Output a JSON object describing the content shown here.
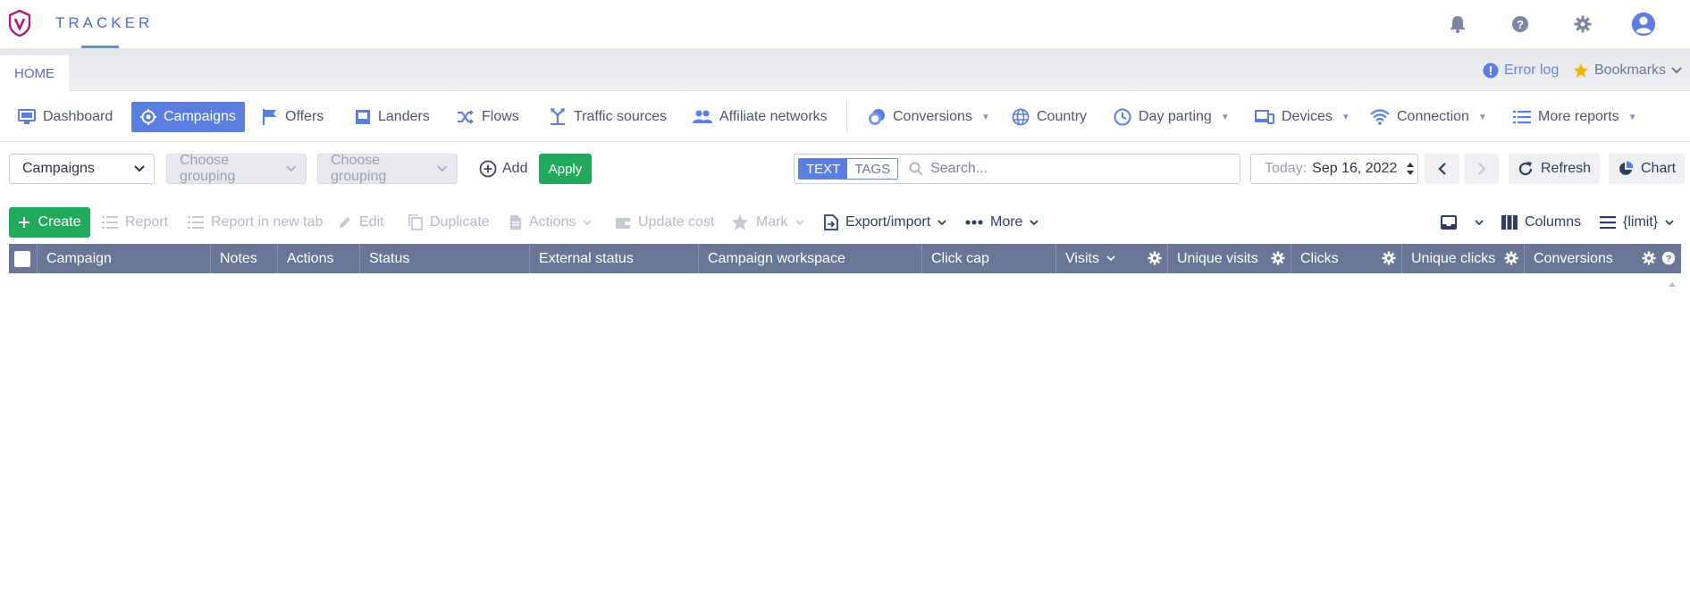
{
  "header": {
    "brand": "TRACKER",
    "icons": [
      "bell-icon",
      "help-icon",
      "gear-icon",
      "account-icon"
    ]
  },
  "tabs": {
    "home": "HOME",
    "error_log": "Error log",
    "bookmarks": "Bookmarks"
  },
  "nav": {
    "items": [
      {
        "label": "Dashboard",
        "icon": "monitor-icon"
      },
      {
        "label": "Campaigns",
        "icon": "target-icon",
        "active": true
      },
      {
        "label": "Offers",
        "icon": "flag-icon"
      },
      {
        "label": "Landers",
        "icon": "lander-icon"
      },
      {
        "label": "Flows",
        "icon": "shuffle-icon"
      },
      {
        "label": "Traffic sources",
        "icon": "split-icon"
      },
      {
        "label": "Affiliate networks",
        "icon": "people-icon"
      },
      {
        "label": "Conversions",
        "icon": "coins-icon"
      },
      {
        "label": "Country",
        "icon": "globe-icon"
      },
      {
        "label": "Day parting",
        "icon": "clock-icon"
      },
      {
        "label": "Devices",
        "icon": "devices-icon"
      },
      {
        "label": "Connection",
        "icon": "wifi-icon"
      },
      {
        "label": "More reports",
        "icon": "list-icon"
      }
    ]
  },
  "filters": {
    "entity_select": "Campaigns",
    "grouping_1": "Choose grouping",
    "grouping_2": "Choose grouping",
    "add": "Add",
    "apply": "Apply",
    "search_mode_text": "TEXT",
    "search_mode_tags": "TAGS",
    "search_placeholder": "Search...",
    "date_label": "Today:",
    "date_value": "Sep 16, 2022",
    "refresh": "Refresh",
    "chart": "Chart"
  },
  "toolbar": {
    "create": "Create",
    "report": "Report",
    "report_new_tab": "Report in new tab",
    "edit": "Edit",
    "duplicate": "Duplicate",
    "actions": "Actions",
    "update_cost": "Update cost",
    "mark": "Mark",
    "export_import": "Export/import",
    "more": "More",
    "columns": "Columns",
    "limit": "{limit}"
  },
  "table": {
    "columns": [
      "Campaign",
      "Notes",
      "Actions",
      "Status",
      "External status",
      "Campaign workspace",
      "Click cap",
      "Visits",
      "Unique visits",
      "Clicks",
      "Unique clicks",
      "Conversions"
    ]
  },
  "colors": {
    "accent": "#5b7fe0",
    "primary_green": "#22a95b",
    "table_header": "#6a7695",
    "logo": "#b0177f",
    "star": "#f2b600"
  }
}
